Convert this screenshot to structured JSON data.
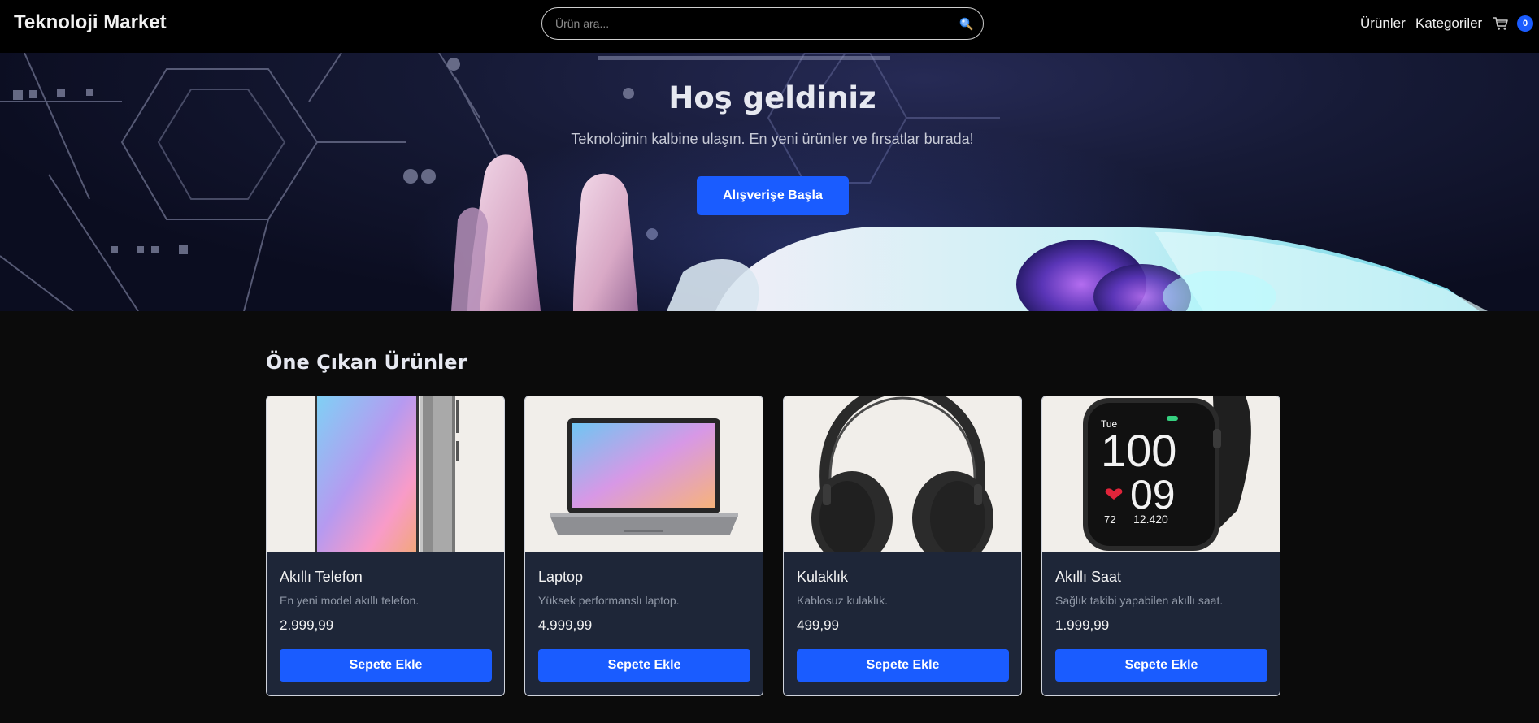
{
  "header": {
    "brand": "Teknoloji Market",
    "search_placeholder": "Ürün ara...",
    "search_icon": "search-icon",
    "nav_products": "Ürünler",
    "nav_categories": "Kategoriler",
    "cart_icon": "cart-icon",
    "cart_count": "0"
  },
  "hero": {
    "title": "Hoş geldiniz",
    "subtitle": "Teknolojinin kalbine ulaşın. En yeni ürünler ve fırsatlar burada!",
    "cta": "Alışverişe Başla"
  },
  "featured": {
    "title": "Öne Çıkan Ürünler",
    "products": [
      {
        "name": "Akıllı Telefon",
        "description": "En yeni model akıllı telefon.",
        "price": "2.999,99",
        "button": "Sepete Ekle"
      },
      {
        "name": "Laptop",
        "description": "Yüksek performanslı laptop.",
        "price": "4.999,99",
        "button": "Sepete Ekle"
      },
      {
        "name": "Kulaklık",
        "description": "Kablosuz kulaklık.",
        "price": "499,99",
        "button": "Sepete Ekle"
      },
      {
        "name": "Akıllı Saat",
        "description": "Sağlık takibi yapabilen akıllı saat.",
        "price": "1.999,99",
        "button": "Sepete Ekle"
      }
    ]
  },
  "watch_face": {
    "day": "Tue",
    "hour": "100",
    "minute": "09",
    "heart_rate": "72",
    "steps": "12.420"
  },
  "colors": {
    "accent": "#1a5cff",
    "card_bg": "#1e2638",
    "page_bg": "#0b0b0b",
    "navbar_bg": "#000000"
  }
}
